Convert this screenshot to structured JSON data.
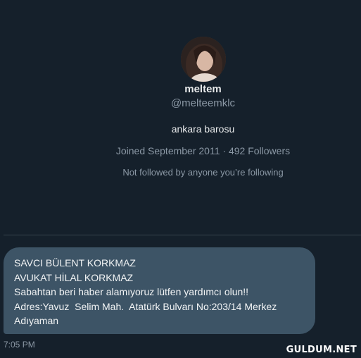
{
  "profile": {
    "display_name": "meltem",
    "handle": "@melteemklc",
    "bio": "ankara barosu",
    "joined": "Joined September 2011",
    "followers": "492 Followers",
    "separator": "·",
    "followed_by": "Not followed by anyone you’re following",
    "avatar_icon": "profile-photo"
  },
  "message": {
    "lines": [
      "SAVCI BÜLENT KORKMAZ",
      "AVUKAT HİLAL KORKMAZ",
      "Sabahtan beri haber alamıyoruz lütfen yardımcı olun!!",
      "Adres:Yavuz  Selim Mah.  Atatürk Bulvarı No:203/14 Merkez",
      "Adıyaman"
    ],
    "time": "7:05 PM"
  },
  "watermark": "GULDUM.NET",
  "colors": {
    "background": "#15202b",
    "bubble": "#3d5466",
    "secondary_text": "#8b98a5"
  }
}
